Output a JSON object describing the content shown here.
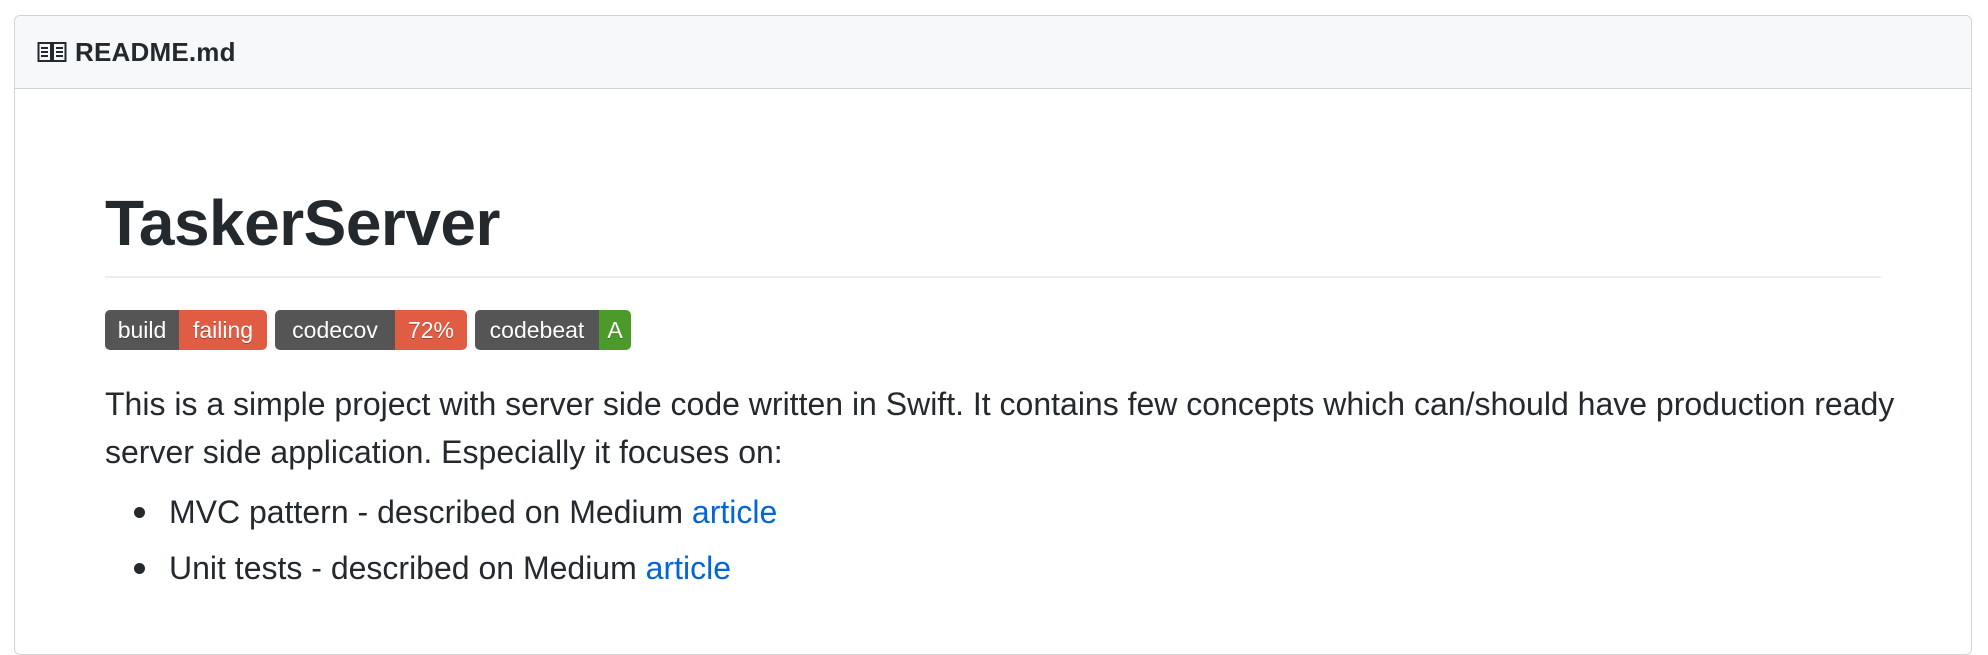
{
  "header": {
    "icon": "book-icon",
    "filename": "README.md"
  },
  "readme": {
    "title": "TaskerServer",
    "badges": [
      {
        "label": "build",
        "value": "failing",
        "color": "#e05d44"
      },
      {
        "label": "codecov",
        "value": "72%",
        "color": "#e05d44"
      },
      {
        "label": "codebeat",
        "value": "A",
        "color": "#4c9a2a"
      }
    ],
    "paragraph": "This is a simple project with server side code written in Swift. It contains few concepts which can/should have production ready server side application. Especially it focuses on:",
    "list": [
      {
        "text": "MVC pattern - described on Medium ",
        "link": "article"
      },
      {
        "text": "Unit tests - described on Medium ",
        "link": "article"
      }
    ]
  },
  "colors": {
    "link": "#0366d6",
    "text": "#24292e",
    "header_bg": "#f6f8fa",
    "border": "#d1d5da"
  }
}
